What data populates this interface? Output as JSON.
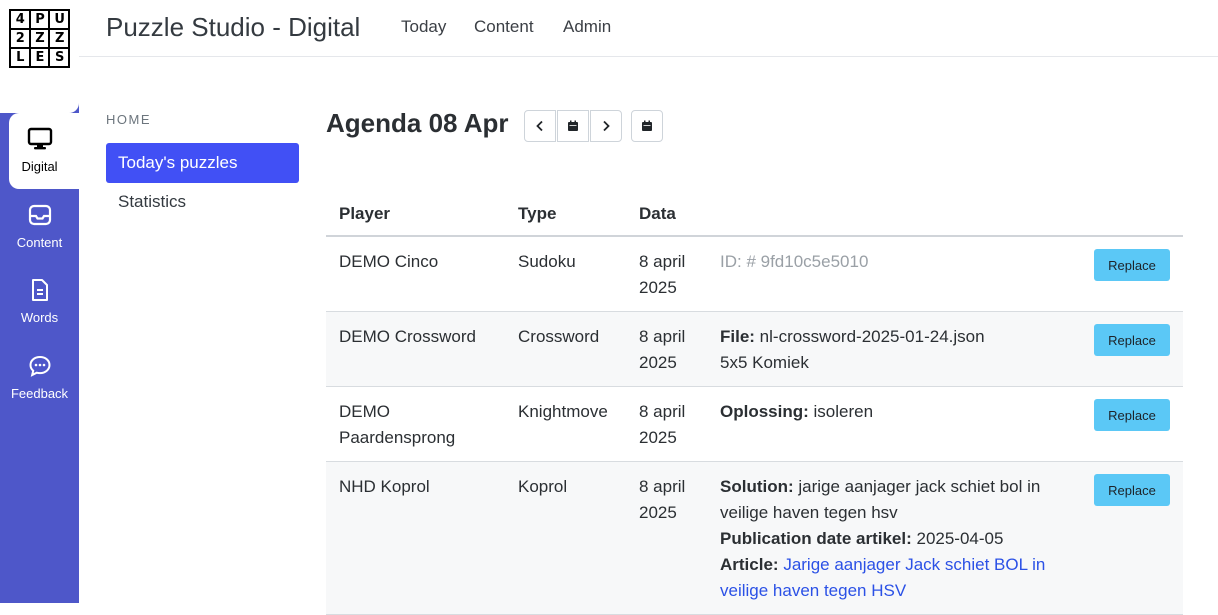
{
  "logo": {
    "letters": [
      "4",
      "P",
      "U",
      "2",
      "Z",
      "Z",
      "L",
      "E",
      "S"
    ]
  },
  "rail": {
    "items": [
      {
        "label": "Digital",
        "icon": "monitor-icon"
      },
      {
        "label": "Content",
        "icon": "inbox-icon"
      },
      {
        "label": "Words",
        "icon": "document-icon"
      },
      {
        "label": "Feedback",
        "icon": "chat-icon"
      }
    ]
  },
  "header": {
    "title": "Puzzle Studio - Digital",
    "nav": [
      "Today",
      "Content",
      "Admin"
    ]
  },
  "sidebar": {
    "section": "HOME",
    "items": [
      {
        "label": "Today's puzzles"
      },
      {
        "label": "Statistics"
      }
    ]
  },
  "agenda": {
    "title": "Agenda 08 Apr"
  },
  "table": {
    "headers": [
      "Player",
      "Type",
      "Data"
    ],
    "button_label": "Replace",
    "rows": [
      {
        "player": "DEMO Cinco",
        "type": "Sudoku",
        "date": "8 april 2025",
        "id_text": "ID: # 9fd10c5e5010"
      },
      {
        "player": "DEMO Crossword",
        "type": "Crossword",
        "date": "8 april 2025",
        "file_label": "File:",
        "file_value": " nl-crossword-2025-01-24.json",
        "extra": "5x5 Komiek"
      },
      {
        "player": "DEMO Paardensprong",
        "type": "Knightmove",
        "date": "8 april 2025",
        "sol_label": "Oplossing:",
        "sol_value": " isoleren"
      },
      {
        "player": "NHD Koprol",
        "type": "Koprol",
        "date": "8 april 2025",
        "sol_label": "Solution:",
        "sol_value": " jarige aanjager jack schiet bol in veilige haven tegen hsv",
        "pub_label": "Publication date artikel:",
        "pub_value": " 2025-04-05",
        "art_label": "Article:",
        "art_value": "Jarige aanjager Jack schiet BOL in veilige haven tegen HSV"
      }
    ]
  },
  "colors": {
    "rail": "#4e57c9",
    "active_nav": "#4150f5",
    "replace_button": "#5bc8f6",
    "link": "#2b51e6"
  }
}
